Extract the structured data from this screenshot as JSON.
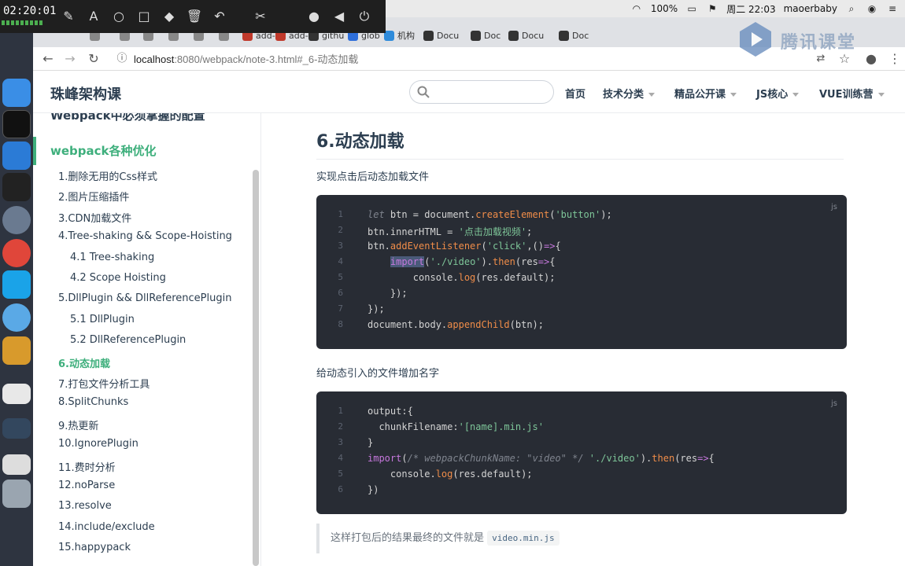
{
  "recorder": {
    "time": "02:20:01"
  },
  "menubar": {
    "battery": "100%",
    "datetime": "周二 22:03",
    "user": "maoerbaby"
  },
  "tabs": [
    {
      "label": "",
      "color": "#888"
    },
    {
      "label": "",
      "color": "#888"
    },
    {
      "label": "",
      "color": "#888"
    },
    {
      "label": "",
      "color": "#888"
    },
    {
      "label": "",
      "color": "#888"
    },
    {
      "label": "",
      "color": "#888"
    },
    {
      "label": "add-",
      "color": "#c0392b"
    },
    {
      "label": "add-",
      "color": "#c0392b"
    },
    {
      "label": "githu",
      "color": "#333"
    },
    {
      "label": "glob",
      "color": "#2e6fdb"
    },
    {
      "label": "机构",
      "color": "#2e8bdb"
    },
    {
      "label": "Docu",
      "color": "#333"
    },
    {
      "label": "Doc",
      "color": "#333"
    },
    {
      "label": "Docu",
      "color": "#333"
    },
    {
      "label": "Doc",
      "color": "#333"
    }
  ],
  "watermark": {
    "text": "腾讯课堂"
  },
  "address": {
    "host": "localhost",
    "rest": ":8080/webpack/note-3.html#_6-动态加载"
  },
  "site": {
    "title": "珠峰架构课",
    "search_placeholder": "",
    "nav": [
      {
        "label": "首页",
        "dropdown": false
      },
      {
        "label": "技术分类",
        "dropdown": true
      },
      {
        "label": "精品公开课",
        "dropdown": true
      },
      {
        "label": "JS核心",
        "dropdown": true
      },
      {
        "label": "VUE训练营",
        "dropdown": true
      }
    ]
  },
  "sidebar": {
    "prev_heading": "Webpack中必须掌握的配置",
    "group": "webpack各种优化",
    "items": [
      {
        "label": "1.删除无用的Css样式",
        "level": 1
      },
      {
        "label": "2.图片压缩插件",
        "level": 1
      },
      {
        "label": "3.CDN加载文件",
        "level": 1
      },
      {
        "label": "4.Tree-shaking && Scope-Hoisting",
        "level": 1
      },
      {
        "label": "4.1 Tree-shaking",
        "level": 2
      },
      {
        "label": "4.2 Scope Hoisting",
        "level": 2
      },
      {
        "label": "5.DllPlugin && DllReferencePlugin",
        "level": 1
      },
      {
        "label": "5.1 DllPlugin",
        "level": 2
      },
      {
        "label": "5.2 DllReferencePlugin",
        "level": 2
      },
      {
        "label": "6.动态加载",
        "level": 1,
        "active": true
      },
      {
        "label": "7.打包文件分析工具",
        "level": 1
      },
      {
        "label": "8.SplitChunks",
        "level": 1
      },
      {
        "label": "9.热更新",
        "level": 1
      },
      {
        "label": "10.IgnorePlugin",
        "level": 1
      },
      {
        "label": "11.费时分析",
        "level": 1
      },
      {
        "label": "12.noParse",
        "level": 1
      },
      {
        "label": "13.resolve",
        "level": 1
      },
      {
        "label": "14.include/exclude",
        "level": 1
      },
      {
        "label": "15.happypack",
        "level": 1
      }
    ]
  },
  "content": {
    "heading": "6.动态加载",
    "para1": "实现点击后动态加载文件",
    "code1": {
      "lang": "js",
      "lines": [
        [
          {
            "t": "let ",
            "c": "cm"
          },
          {
            "t": "btn = document.",
            "c": ""
          },
          {
            "t": "createElement",
            "c": "fn"
          },
          {
            "t": "(",
            "c": ""
          },
          {
            "t": "'button'",
            "c": "st"
          },
          {
            "t": ");",
            "c": ""
          }
        ],
        [
          {
            "t": "btn.innerHTML = ",
            "c": ""
          },
          {
            "t": "'点击加载视频'",
            "c": "st"
          },
          {
            "t": ";",
            "c": ""
          }
        ],
        [
          {
            "t": "btn.",
            "c": ""
          },
          {
            "t": "addEventListener",
            "c": "fn"
          },
          {
            "t": "(",
            "c": ""
          },
          {
            "t": "'click'",
            "c": "st"
          },
          {
            "t": ",()",
            "c": ""
          },
          {
            "t": "=>",
            "c": "op"
          },
          {
            "t": "{",
            "c": ""
          }
        ],
        [
          {
            "t": "    ",
            "c": ""
          },
          {
            "t": "import",
            "c": "kw hl"
          },
          {
            "t": "(",
            "c": ""
          },
          {
            "t": "'./video'",
            "c": "st"
          },
          {
            "t": ").",
            "c": ""
          },
          {
            "t": "then",
            "c": "fn"
          },
          {
            "t": "(res",
            "c": ""
          },
          {
            "t": "=>",
            "c": "op"
          },
          {
            "t": "{",
            "c": ""
          }
        ],
        [
          {
            "t": "        console.",
            "c": ""
          },
          {
            "t": "log",
            "c": "fn"
          },
          {
            "t": "(res.default);",
            "c": ""
          }
        ],
        [
          {
            "t": "    });",
            "c": ""
          }
        ],
        [
          {
            "t": "});",
            "c": ""
          }
        ],
        [
          {
            "t": "document.body.",
            "c": ""
          },
          {
            "t": "appendChild",
            "c": "fn"
          },
          {
            "t": "(btn);",
            "c": ""
          }
        ]
      ]
    },
    "para2": "给动态引入的文件增加名字",
    "code2": {
      "lang": "js",
      "lines": [
        [
          {
            "t": "output:{",
            "c": ""
          }
        ],
        [
          {
            "t": "  chunkFilename:",
            "c": ""
          },
          {
            "t": "'[name].min.js'",
            "c": "st"
          }
        ],
        [
          {
            "t": "}",
            "c": ""
          }
        ],
        [
          {
            "t": "import",
            "c": "kw"
          },
          {
            "t": "(",
            "c": ""
          },
          {
            "t": "/* webpackChunkName: \"video\" */",
            "c": "cm"
          },
          {
            "t": " ",
            "c": ""
          },
          {
            "t": "'./video'",
            "c": "st"
          },
          {
            "t": ").",
            "c": ""
          },
          {
            "t": "then",
            "c": "fn"
          },
          {
            "t": "(res",
            "c": ""
          },
          {
            "t": "=>",
            "c": "op"
          },
          {
            "t": "{",
            "c": ""
          }
        ],
        [
          {
            "t": "    console.",
            "c": ""
          },
          {
            "t": "log",
            "c": "fn"
          },
          {
            "t": "(res.default);",
            "c": ""
          }
        ],
        [
          {
            "t": "})",
            "c": ""
          }
        ]
      ]
    },
    "tip_text": "这样打包后的结果最终的文件就是",
    "tip_code": "video.min.js"
  }
}
